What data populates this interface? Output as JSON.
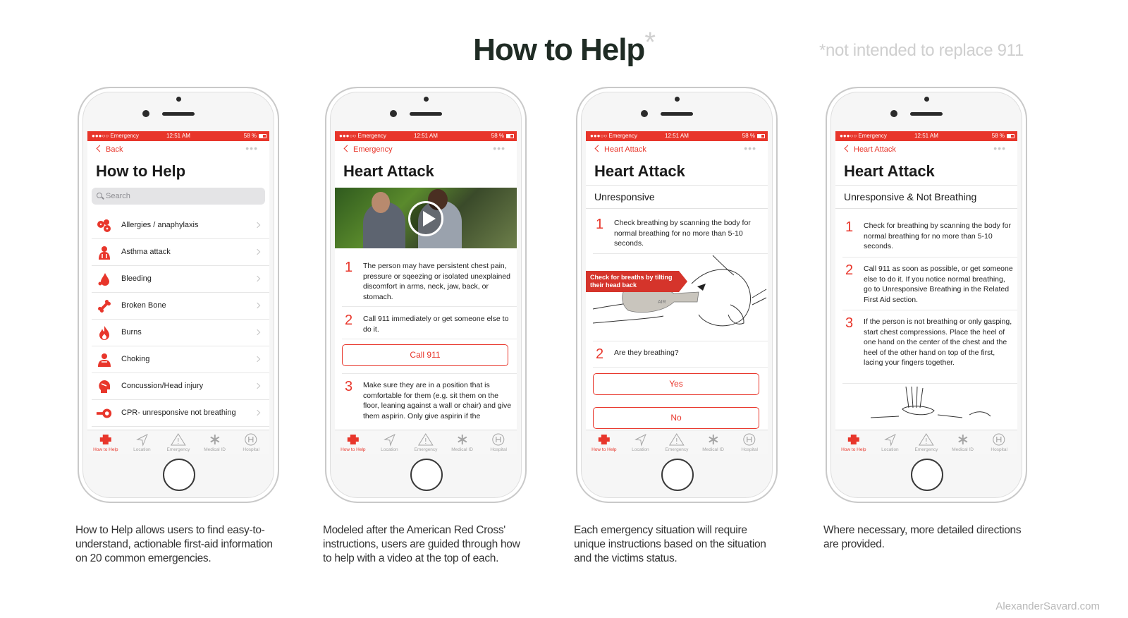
{
  "header": {
    "title": "How to Help",
    "title_asterisk": "*",
    "disclaimer": "*not intended to replace 911"
  },
  "footer": {
    "credit": "AlexanderSavard.com"
  },
  "status_bar": {
    "carrier": "●●●○○ Emergency",
    "time": "12:51 AM",
    "battery": "58 %"
  },
  "tab_bar": [
    {
      "label": "How to Help",
      "icon": "red-cross-icon"
    },
    {
      "label": "Location",
      "icon": "location-arrow-icon"
    },
    {
      "label": "Emergency",
      "icon": "warning-triangle-icon"
    },
    {
      "label": "Medical ID",
      "icon": "medical-asterisk-icon"
    },
    {
      "label": "Hospital",
      "icon": "hospital-h-icon"
    }
  ],
  "phone1": {
    "back": "Back",
    "more": "•••",
    "title": "How to Help",
    "search_placeholder": "Search",
    "items": [
      {
        "label": "Allergies / anaphylaxis",
        "icon": "allergy-icon"
      },
      {
        "label": "Asthma attack",
        "icon": "lungs-icon"
      },
      {
        "label": "Bleeding",
        "icon": "blood-drop-icon"
      },
      {
        "label": "Broken Bone",
        "icon": "bone-icon"
      },
      {
        "label": "Burns",
        "icon": "flame-icon"
      },
      {
        "label": "Choking",
        "icon": "choking-person-icon"
      },
      {
        "label": "Concussion/Head injury",
        "icon": "head-injury-icon"
      },
      {
        "label": "CPR- unresponsive not breathing",
        "icon": "cpr-icon"
      }
    ]
  },
  "phone2": {
    "back": "Emergency",
    "more": "•••",
    "title": "Heart Attack",
    "steps": [
      {
        "num": "1",
        "text": "The person may have persistent  chest pain, pressure or sqeezing or isolated unexplained discomfort in arms, neck, jaw, back, or stomach."
      },
      {
        "num": "2",
        "text": "Call 911 immediately or get someone else to do it."
      },
      {
        "num": "3",
        "text": "Make sure they are in a position that is comfortable for them (e.g. sit them on the floor, leaning against a wall or chair) and give them aspirin. Only give aspirin if the"
      }
    ],
    "call_button": "Call 911"
  },
  "phone3": {
    "back": "Heart Attack",
    "more": "•••",
    "title": "Heart Attack",
    "section": "Unresponsive",
    "steps": [
      {
        "num": "1",
        "text": "Check breathing by scanning the body for normal breathing for no more than 5-10 seconds."
      },
      {
        "num": "2",
        "text": "Are they breathing?"
      }
    ],
    "illustration_banner": "Check for breaths by tilting their head back",
    "illustration_label": "AIR",
    "yes_button": "Yes",
    "no_button": "No"
  },
  "phone4": {
    "back": "Heart Attack",
    "more": "•••",
    "title": "Heart Attack",
    "section": "Unresponsive & Not Breathing",
    "steps": [
      {
        "num": "1",
        "text": "Check for breathing by scanning the body for normal breathing for no more than 5-10 seconds."
      },
      {
        "num": "2",
        "text": "Call 911 as soon as possible, or get someone else to do it. If you notice normal breathing, go to Unresponsive Breathing in the Related First Aid section."
      },
      {
        "num": "3",
        "text": "If the person is not breathing or only gasping, start chest compressions. Place the heel of one hand on the center of the chest and the heel of the other hand on top of the first, lacing your fingers together."
      }
    ]
  },
  "captions": [
    "How to Help allows users to find easy-to-understand, actionable first-aid information on 20 common emergencies.",
    "Modeled after the American Red Cross' instructions, users are guided through how to help with a video at the top of each.",
    "Each emergency situation will require unique instructions based on the situation and the victims status.",
    "Where necessary, more detailed directions are provided."
  ],
  "colors": {
    "accent": "#e8362b",
    "title": "#1f2b24",
    "muted": "#cfcfcf"
  }
}
